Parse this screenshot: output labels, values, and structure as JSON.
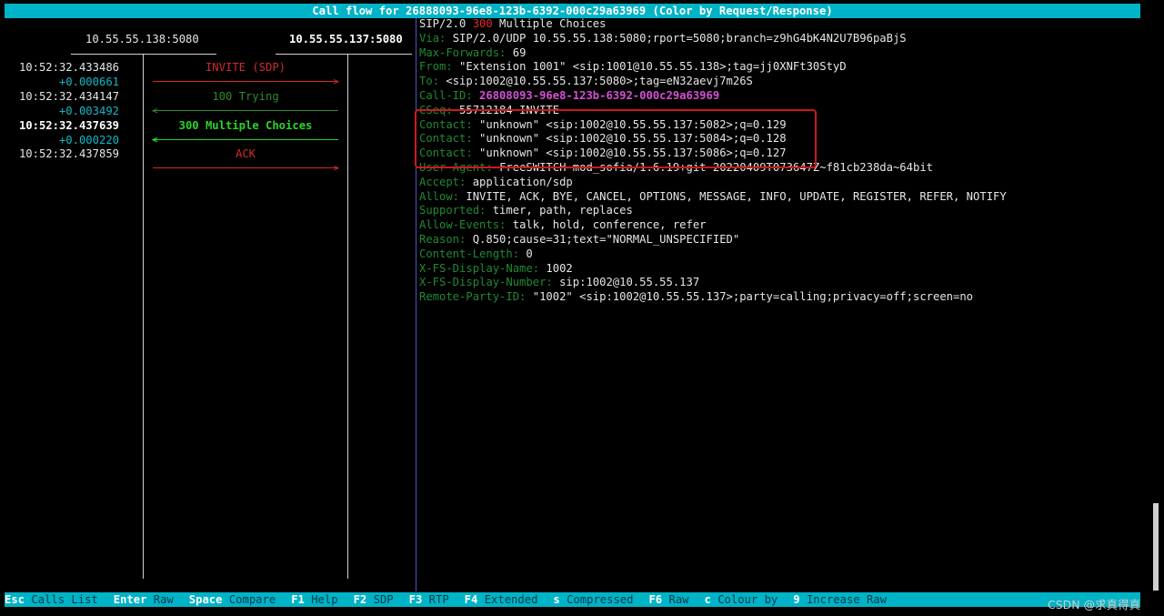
{
  "title": "Call flow for 26888093-96e8-123b-6392-000c29a63969 (Color by Request/Response)",
  "hosts": {
    "left": "10.55.55.138:5080",
    "right": "10.55.55.137:5080"
  },
  "flow": {
    "rows": [
      {
        "timestamp": "10:52:32.433486",
        "delta": "+0.000661",
        "label": "INVITE (SDP)",
        "direction": "right",
        "color": "#d12b2b"
      },
      {
        "timestamp": "",
        "delta": "+0.003492",
        "label": "100 Trying",
        "direction": "left",
        "color": "#2c8b2c"
      },
      {
        "timestamp": "10:52:32.437639",
        "delta": "+0.000220",
        "label": "300 Multiple Choices",
        "direction": "left",
        "color": "#2bd32b"
      },
      {
        "timestamp": "10:52:32.437859",
        "delta": "",
        "label": "ACK",
        "direction": "right",
        "color": "#d12b2b"
      }
    ],
    "timestamps": [
      "10:52:32.433486",
      "10:52:32.434147",
      "10:52:32.437639",
      "10:52:32.437859"
    ],
    "deltas": [
      "+0.000661",
      "+0.003492",
      "+0.000220"
    ]
  },
  "sip": {
    "status_prefix": "SIP/2.0 ",
    "status_code": "300",
    "status_text": " Multiple Choices",
    "headers": [
      {
        "name": "Via: ",
        "value": "SIP/2.0/UDP 10.55.55.138:5080;rport=5080;branch=z9hG4bK4N2U7B96paBjS"
      },
      {
        "name": "Max-Forwards: ",
        "value": "69"
      },
      {
        "name": "From: ",
        "value": "\"Extension 1001\" <sip:1001@10.55.55.138>;tag=jj0XNFt30StyD"
      },
      {
        "name": "To: ",
        "value": "<sip:1002@10.55.55.137:5080>;tag=eN32aevj7m26S"
      },
      {
        "name": "Call-ID: ",
        "value": "26808093-96e8-123b-6392-000c29a63969"
      },
      {
        "name": "CSeq: ",
        "value": "55712184 INVITE"
      },
      {
        "name": "Contact: ",
        "value": "\"unknown\" <sip:1002@10.55.55.137:5082>;q=0.129"
      },
      {
        "name": "Contact: ",
        "value": "\"unknown\" <sip:1002@10.55.55.137:5084>;q=0.128"
      },
      {
        "name": "Contact: ",
        "value": "\"unknown\" <sip:1002@10.55.55.137:5086>;q=0.127"
      },
      {
        "name": "User-Agent: ",
        "value": "FreeSWITCH-mod_sofia/1.6.19+git~20220409T073647Z~f81cb238da~64bit"
      },
      {
        "name": "Accept: ",
        "value": "application/sdp"
      },
      {
        "name": "Allow: ",
        "value": "INVITE, ACK, BYE, CANCEL, OPTIONS, MESSAGE, INFO, UPDATE, REGISTER, REFER, NOTIFY"
      },
      {
        "name": "Supported: ",
        "value": "timer, path, replaces"
      },
      {
        "name": "Allow-Events: ",
        "value": "talk, hold, conference, refer"
      },
      {
        "name": "Reason: ",
        "value": "Q.850;cause=31;text=\"NORMAL_UNSPECIFIED\""
      },
      {
        "name": "Content-Length: ",
        "value": "0"
      },
      {
        "name": "X-FS-Display-Name: ",
        "value": "1002"
      },
      {
        "name": "X-FS-Display-Number: ",
        "value": "sip:1002@10.55.55.137"
      },
      {
        "name": "Remote-Party-ID: ",
        "value": "\"1002\" <sip:1002@10.55.55.137>;party=calling;privacy=off;screen=no"
      }
    ]
  },
  "shortcuts": [
    {
      "key": "Esc",
      "action": "Calls List"
    },
    {
      "key": "Enter",
      "action": "Raw"
    },
    {
      "key": "Space",
      "action": "Compare"
    },
    {
      "key": "F1",
      "action": "Help"
    },
    {
      "key": "F2",
      "action": "SDP"
    },
    {
      "key": "F3",
      "action": "RTP"
    },
    {
      "key": "F4",
      "action": "Extended"
    },
    {
      "key": "s",
      "action": "Compressed"
    },
    {
      "key": "F6",
      "action": "Raw"
    },
    {
      "key": "c",
      "action": "Colour by"
    },
    {
      "key": "9",
      "action": "Increase Raw"
    }
  ],
  "watermark": "CSDN @求真得真",
  "colors": {
    "bar": "#00b3c6",
    "highlight": "#d01818",
    "divider": "#4a56c4"
  }
}
